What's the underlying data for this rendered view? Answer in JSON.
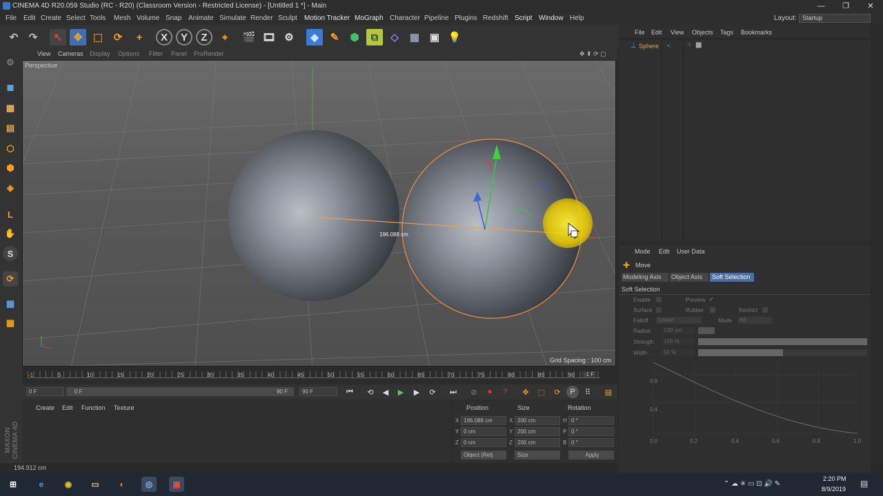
{
  "window": {
    "title": "CINEMA 4D R20.059 Studio (RC - R20) (Classroom Version - Restricted License) - [Untitled 1 *] - Main",
    "controls": [
      "—",
      "❐",
      "✕"
    ]
  },
  "menubar": {
    "items": [
      "File",
      "Edit",
      "Create",
      "Select",
      "Tools",
      "Mesh",
      "Volume",
      "Snap",
      "Animate",
      "Simulate",
      "Render",
      "Sculpt",
      "Motion Tracker",
      "MoGraph",
      "Character",
      "Pipeline",
      "Plugins",
      "Redshift",
      "Script",
      "Window",
      "Help"
    ],
    "layout_label": "Layout:",
    "layout_value": "Startup"
  },
  "viewport": {
    "menu": [
      "View",
      "Cameras",
      "Display",
      "Options",
      "Filter",
      "Panel",
      "ProRender"
    ],
    "camera_label": "Perspective",
    "measure_label": "196.088 cm",
    "grid_spacing": "Grid Spacing : 100 cm"
  },
  "timeline": {
    "ticks": [
      "-1",
      "5",
      "10",
      "15",
      "20",
      "25",
      "30",
      "35",
      "40",
      "45",
      "50",
      "55",
      "60",
      "65",
      "70",
      "75",
      "80",
      "85",
      "90"
    ],
    "frame_indicator": "-1 F",
    "current_frame": "0 F",
    "range_start": "0 F",
    "range_end": "90 F",
    "end_frame": "90 F"
  },
  "materials": {
    "menu": [
      "Create",
      "Edit",
      "Function",
      "Texture"
    ],
    "logo": "MAXON CINEMA 4D"
  },
  "coordinates": {
    "headers": [
      "Position",
      "Size",
      "Rotation"
    ],
    "rows": [
      {
        "axis": "X",
        "pos": "196.088 cm",
        "saxis": "X",
        "size": "200 cm",
        "raxis": "H",
        "rot": "0 °"
      },
      {
        "axis": "Y",
        "pos": "0 cm",
        "saxis": "Y",
        "size": "200 cm",
        "raxis": "P",
        "rot": "0 °"
      },
      {
        "axis": "Z",
        "pos": "0 cm",
        "saxis": "Z",
        "size": "200 cm",
        "raxis": "B",
        "rot": "0 °"
      }
    ],
    "mode": "Object (Rel)",
    "size_mode": "Size",
    "apply": "Apply"
  },
  "object_manager": {
    "menu": [
      "File",
      "Edit",
      "View",
      "Objects",
      "Tags",
      "Bookmarks"
    ],
    "objects": [
      {
        "name": "Sphere"
      }
    ]
  },
  "attributes": {
    "menu": [
      "Mode",
      "Edit",
      "User Data"
    ],
    "tool_name": "Move",
    "tabs": [
      "Modeling Axis",
      "Object Axis",
      "Soft Selection"
    ],
    "active_tab": "Soft Selection",
    "section_title": "Soft Selection",
    "enable_label": "Enable",
    "preview_label": "Preview",
    "preview_check": "✓",
    "surface_label": "Surface",
    "rubber_label": "Rubber",
    "restrict_label": "Restrict",
    "falloff_label": "Falloff",
    "falloff_value": "Linear",
    "mode_label": "Mode",
    "mode_value": "All",
    "radius_label": "Radius",
    "radius_value": "100 cm",
    "strength_label": "Strength",
    "strength_value": "100 %",
    "width_label": "Width . .",
    "width_value": "50 %",
    "strength_fill": 1.0,
    "width_fill": 0.5,
    "graph_y": [
      "0.8",
      "0.4",
      "0.0"
    ],
    "graph_x": [
      "0.2",
      "0.4",
      "0.6",
      "0.8",
      "1.0"
    ]
  },
  "status": {
    "text": "194.912 cm"
  },
  "taskbar": {
    "time": "2:20 PM",
    "date": "8/9/2019"
  }
}
